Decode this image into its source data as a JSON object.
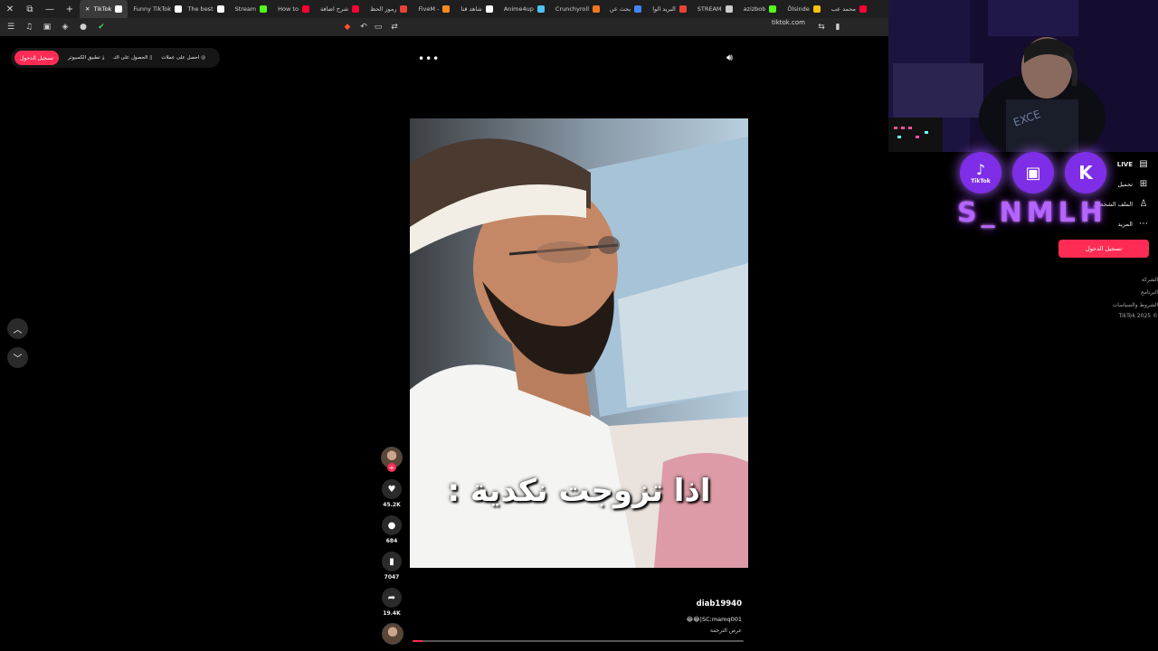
{
  "browser": {
    "tabs": [
      {
        "title": "TikTok",
        "icon": "tiktok-icon",
        "color": "#ffffff",
        "active": true
      },
      {
        "title": "Funny TikTok",
        "icon": "tiktok-icon",
        "color": "#ffffff"
      },
      {
        "title": "The best",
        "icon": "diamond-icon",
        "color": "#ffffff"
      },
      {
        "title": "Stream",
        "icon": "kick-icon",
        "color": "#53fc18"
      },
      {
        "title": "How to",
        "icon": "youtube-icon",
        "color": "#ff0033"
      },
      {
        "title": "شرح اضافة",
        "icon": "youtube-icon",
        "color": "#ff0033"
      },
      {
        "title": "رموز الحظ",
        "icon": "gmail-icon",
        "color": "#ea4335"
      },
      {
        "title": "FiveM -",
        "icon": "fivem-icon",
        "color": "#f68b1f"
      },
      {
        "title": "شاهد قنا",
        "icon": "tiktok-icon",
        "color": "#ffffff"
      },
      {
        "title": "Anime4up",
        "icon": "globe-icon",
        "color": "#4fc3f7"
      },
      {
        "title": "Crunchyroll",
        "icon": "crunchyroll-icon",
        "color": "#f47521"
      },
      {
        "title": "بحث عن",
        "icon": "globe-icon",
        "color": "#4285f4"
      },
      {
        "title": "البريد الوا",
        "icon": "gmail-icon",
        "color": "#ea4335"
      },
      {
        "title": "STREAM",
        "icon": "globe-icon",
        "color": "#cccccc"
      },
      {
        "title": "azizbob",
        "icon": "kick-icon",
        "color": "#53fc18"
      },
      {
        "title": "Ölsinde",
        "icon": "yellow-icon",
        "color": "#f4c20d"
      },
      {
        "title": "محمد عب",
        "icon": "youtube-icon",
        "color": "#ff0033"
      }
    ],
    "url": "tiktok.com"
  },
  "tiktok": {
    "top_links": {
      "login": "تسجيل الدخول",
      "desktop_app": "تطبيق الكمبيوتر",
      "get_app": "الحصول على التـ",
      "get_coins": "احصل على عملات"
    },
    "video": {
      "caption": "اذا تزوجت نكدية :",
      "username": "diab19940",
      "description": "😂😂|SC:mamq001",
      "translate": "عرض الترجمة",
      "progress": 0.03
    },
    "actions": {
      "likes": "45.2K",
      "comments": "684",
      "saves": "7047",
      "shares": "19.4K"
    },
    "sidebar": {
      "live": "LIVE",
      "upload": "تحميل",
      "profile": "الملف الشخصي",
      "more": "المزيد",
      "login_button": "تسجيل الدخول",
      "footer": [
        "الشركة",
        "البرنامج",
        "الشروط والسياسات",
        "TikTok 2025 ©"
      ]
    }
  },
  "overlay": {
    "streamer_name": "S_NMLH",
    "socials": [
      {
        "name": "TikTok",
        "icon": "tiktok-icon"
      },
      {
        "name": "Twitch",
        "icon": "twitch-icon"
      },
      {
        "name": "Kick",
        "icon": "kick-icon"
      }
    ],
    "accent": "#a35cff"
  }
}
